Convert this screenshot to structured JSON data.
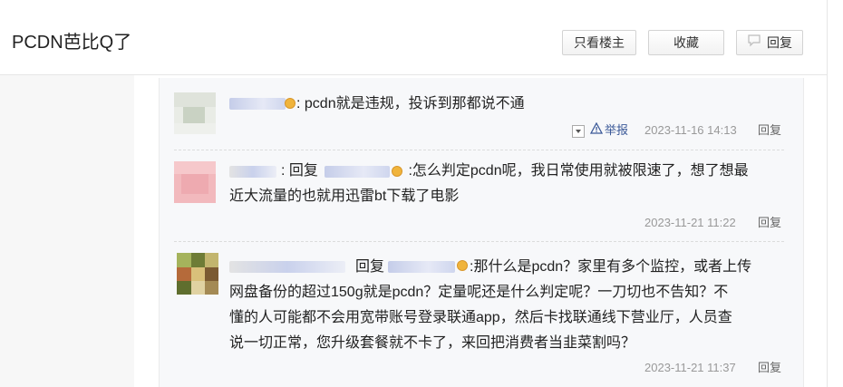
{
  "header": {
    "title": "PCDN芭比Q了",
    "buttons": {
      "only_op": "只看楼主",
      "favorite": "收藏",
      "reply": "回复"
    }
  },
  "comments": [
    {
      "text": ": pcdn就是违规，投诉到那都说不通",
      "report_label": "举报",
      "time": "2023-11-16 14:13",
      "reply_label": "回复"
    },
    {
      "reply_prefix": ": 回复",
      "text_line1": " :怎么判定pcdn呢，我日常使用就被限速了，想了想最",
      "text_line2": "近大流量的也就用迅雷bt下载了电影",
      "time": "2023-11-21 11:22",
      "reply_label": "回复"
    },
    {
      "reply_prefix": "回复",
      "text_line1": ":那什么是pcdn？家里有多个监控，或者上传",
      "text_line2": "网盘备份的超过150g就是pcdn？定量呢还是什么判定呢？一刀切也不告知？不",
      "text_line3": "懂的人可能都不会用宽带账号登录联通app，然后卡找联通线下营业厅，人员查",
      "text_line4": "说一切正常，您升级套餐就不卡了，来回把消费者当韭菜割吗？",
      "time": "2023-11-21 11:37",
      "reply_label": "回复"
    }
  ],
  "icons": {
    "comment_bubble": "speech-bubble-icon",
    "warning": "warning-triangle-icon",
    "dropdown": "dropdown-arrow-icon",
    "badge": "member-badge-icon"
  },
  "colors": {
    "link": "#3b5998",
    "meta": "#999999",
    "panel_bg": "#f7f8fa"
  }
}
